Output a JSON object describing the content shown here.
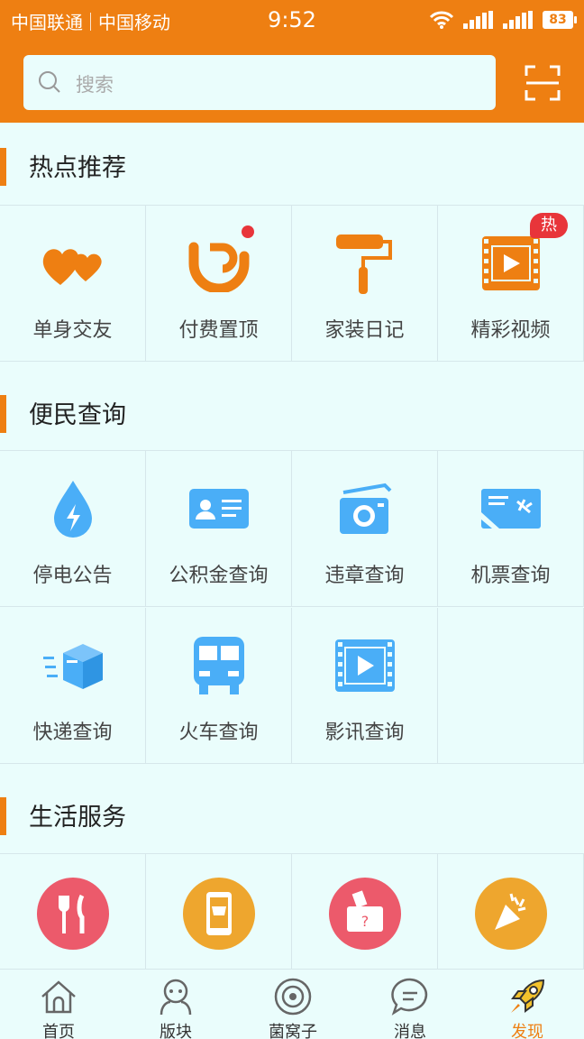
{
  "status_bar": {
    "carrier1": "中国联通",
    "carrier2": "中国移动",
    "time": "9:52",
    "battery": "83"
  },
  "search": {
    "placeholder": "搜索"
  },
  "icons": {
    "search": "search-icon",
    "scan": "scan-icon"
  },
  "sections": [
    {
      "title": "热点推荐",
      "items": [
        {
          "label": "单身交友",
          "icon": "hearts-icon"
        },
        {
          "label": "付费置顶",
          "icon": "pin-top-icon",
          "badge": "dot"
        },
        {
          "label": "家装日记",
          "icon": "paint-roller-icon"
        },
        {
          "label": "精彩视频",
          "icon": "video-film-icon",
          "badge": "热"
        }
      ]
    },
    {
      "title": "便民查询",
      "items": [
        {
          "label": "停电公告",
          "icon": "power-drop-icon"
        },
        {
          "label": "公积金查询",
          "icon": "id-card-icon"
        },
        {
          "label": "违章查询",
          "icon": "camera-icon"
        },
        {
          "label": "机票查询",
          "icon": "plane-ticket-icon"
        },
        {
          "label": "快递查询",
          "icon": "package-icon"
        },
        {
          "label": "火车查询",
          "icon": "bus-icon"
        },
        {
          "label": "影讯查询",
          "icon": "film-icon"
        }
      ]
    },
    {
      "title": "生活服务",
      "items": [
        {
          "label": "",
          "icon": "fork-knife-icon"
        },
        {
          "label": "",
          "icon": "phone-shop-icon"
        },
        {
          "label": "",
          "icon": "gift-box-icon"
        },
        {
          "label": "",
          "icon": "party-popper-icon"
        }
      ]
    }
  ],
  "tabs": [
    {
      "label": "首页",
      "icon": "home-icon"
    },
    {
      "label": "版块",
      "icon": "blocks-icon"
    },
    {
      "label": "菌窝子",
      "icon": "planet-icon"
    },
    {
      "label": "消息",
      "icon": "message-icon"
    },
    {
      "label": "发现",
      "icon": "rocket-icon",
      "active": true
    }
  ],
  "colors": {
    "accent": "#ee7f12",
    "blue": "#4aaef7",
    "background": "#eafdfc",
    "badge": "#e8353a"
  }
}
